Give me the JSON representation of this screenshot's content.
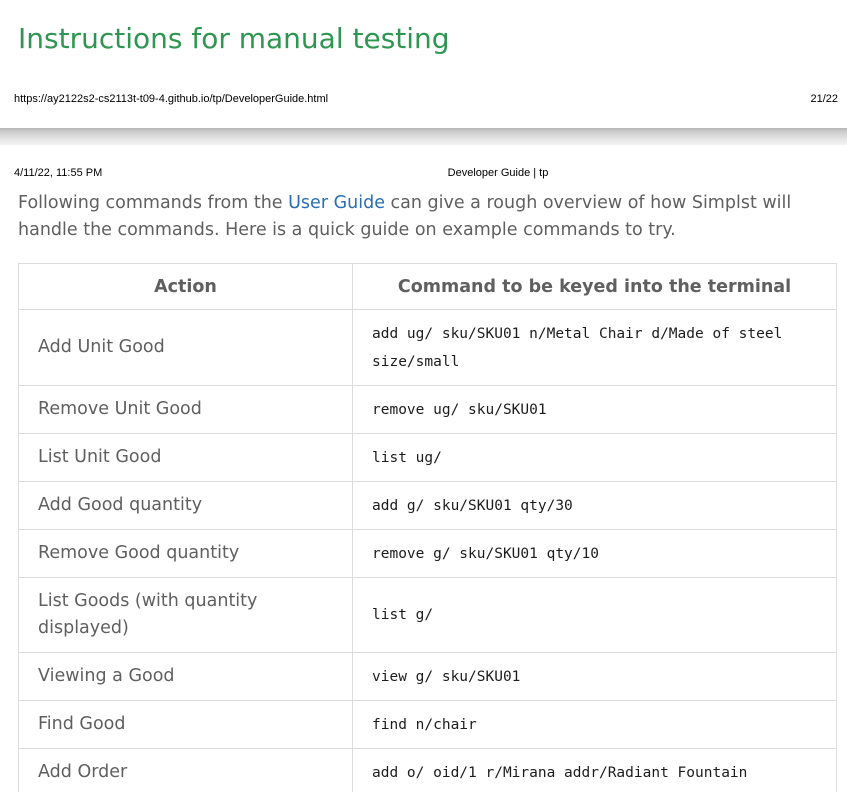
{
  "previous_page": {
    "heading": "Instructions for manual testing",
    "footer_url": "https://ay2122s2-cs2113t-t09-4.github.io/tp/DeveloperGuide.html",
    "footer_page": "21/22"
  },
  "current_page": {
    "header_date": "4/11/22, 11:55 PM",
    "header_title": "Developer Guide | tp",
    "intro": {
      "before_link": "Following commands from the ",
      "link_text": "User Guide",
      "after_link": " can give a rough overview of how Simplst will handle the commands. Here is a quick guide on example commands to try."
    },
    "table": {
      "headers": [
        "Action",
        "Command to be keyed into the terminal"
      ],
      "rows": [
        {
          "action": "Add Unit Good",
          "command": "add ug/ sku/SKU01 n/Metal Chair d/Made of steel size/small"
        },
        {
          "action": "Remove Unit Good",
          "command": "remove ug/ sku/SKU01"
        },
        {
          "action": "List Unit Good",
          "command": "list ug/"
        },
        {
          "action": "Add Good quantity",
          "command": "add g/ sku/SKU01 qty/30"
        },
        {
          "action": "Remove Good quantity",
          "command": "remove g/ sku/SKU01 qty/10"
        },
        {
          "action": "List Goods (with quantity displayed)",
          "command": "list g/"
        },
        {
          "action": "Viewing a Good",
          "command": "view g/ sku/SKU01"
        },
        {
          "action": "Find Good",
          "command": "find n/chair"
        },
        {
          "action": "Add Order",
          "command": "add o/ oid/1 r/Mirana addr/Radiant Fountain"
        }
      ]
    }
  },
  "colors": {
    "heading_green": "#2e9650",
    "link_blue": "#2a6db5",
    "body_text": "#5f5f5f",
    "table_border": "#dcdcdc"
  }
}
